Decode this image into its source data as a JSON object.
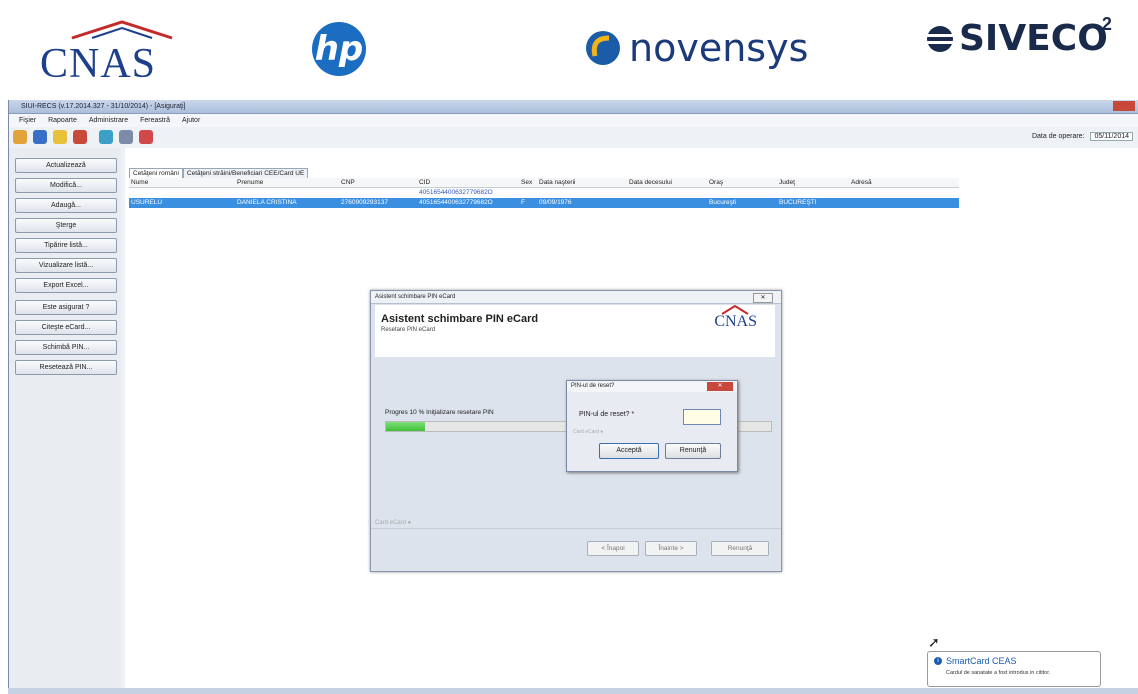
{
  "logos": {
    "cnas": "CNAS",
    "hp": "hp",
    "novensys": "novensys",
    "siveco": "SIVECO",
    "siveco_badge": "2"
  },
  "app": {
    "title": "SIUI-RECS (v.17.2014.327 - 31/10/2014) - [Asiguraţi]",
    "menu": [
      "Fişier",
      "Rapoarte",
      "Administrare",
      "Fereastră",
      "Ajutor"
    ],
    "operation_date_label": "Data de operare:",
    "operation_date_value": "05/11/2014"
  },
  "sidebar": {
    "buttons": [
      "Actualizează",
      "Modifică...",
      "Adaugă...",
      "Şterge",
      "Tipărire listă...",
      "Vizualizare listă...",
      "Export Excel...",
      "Este asigurat ?",
      "Citeşte eCard...",
      "Schimbă PIN...",
      "Resetează PIN..."
    ]
  },
  "tabs": [
    "Cetăţeni români",
    "Cetăţeni străini/Beneficiari CEE/Card UE"
  ],
  "table": {
    "columns": [
      "Nume",
      "Prenume",
      "CNP",
      "CID",
      "Sex",
      "Data naşterii",
      "Data decesului",
      "Oraş",
      "Judeţ",
      "Adresă"
    ],
    "filter_cid": "4051654400632779682O",
    "row": {
      "nume": "USURELU",
      "prenume": "DANIELA CRISTINA",
      "cnp": "2760909293137",
      "cid": "4051654400632779682O",
      "sex": "F",
      "data_nasterii": "09/09/1976",
      "data_decesului": "",
      "oras": "Bucureşti",
      "judet": "BUCUREŞTI",
      "adresa": ""
    }
  },
  "wizard": {
    "window_title": "Asistent schimbare PIN eCard",
    "heading": "Asistent schimbare PIN eCard",
    "subheading": "Resetare PIN eCard",
    "logo_text": "CNAS",
    "progress_label": "Progres 10 % Iniţializare resetare PIN",
    "progress_percent": 10,
    "footer_hint": "Card eCard ●",
    "back_button": "< Înapoi",
    "next_button": "Înainte >",
    "cancel_button": "Renunţă"
  },
  "pin_dialog": {
    "title": "PIN-ul de reset?",
    "label": "PIN-ul de reset? *",
    "hint": "Card eCard ●",
    "accept_button": "Acceptă",
    "cancel_button": "Renunţă"
  },
  "notification": {
    "title": "SmartCard CEAS",
    "message": "Cardul de sanatate a fost introdus in cititor."
  },
  "colors": {
    "selection": "#3b8fe0",
    "progress": "#3fbf3a",
    "close": "#c8483c"
  }
}
